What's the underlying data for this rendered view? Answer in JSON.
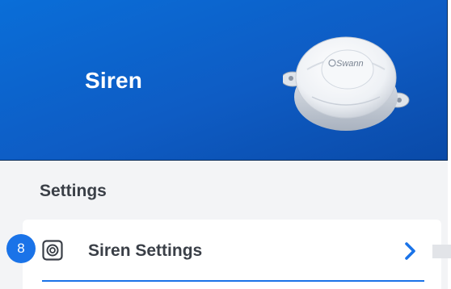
{
  "header": {
    "title": "Siren",
    "device_brand": "Swann"
  },
  "settings_section": {
    "title": "Settings",
    "items": [
      {
        "label": "Siren Settings",
        "icon": "siren-speaker-icon",
        "badge": "8"
      }
    ]
  },
  "colors": {
    "header_blue": "#0e5cc4",
    "accent_blue": "#1a73e8",
    "text_dark": "#3a3f47",
    "background_gray": "#f3f4f6"
  }
}
